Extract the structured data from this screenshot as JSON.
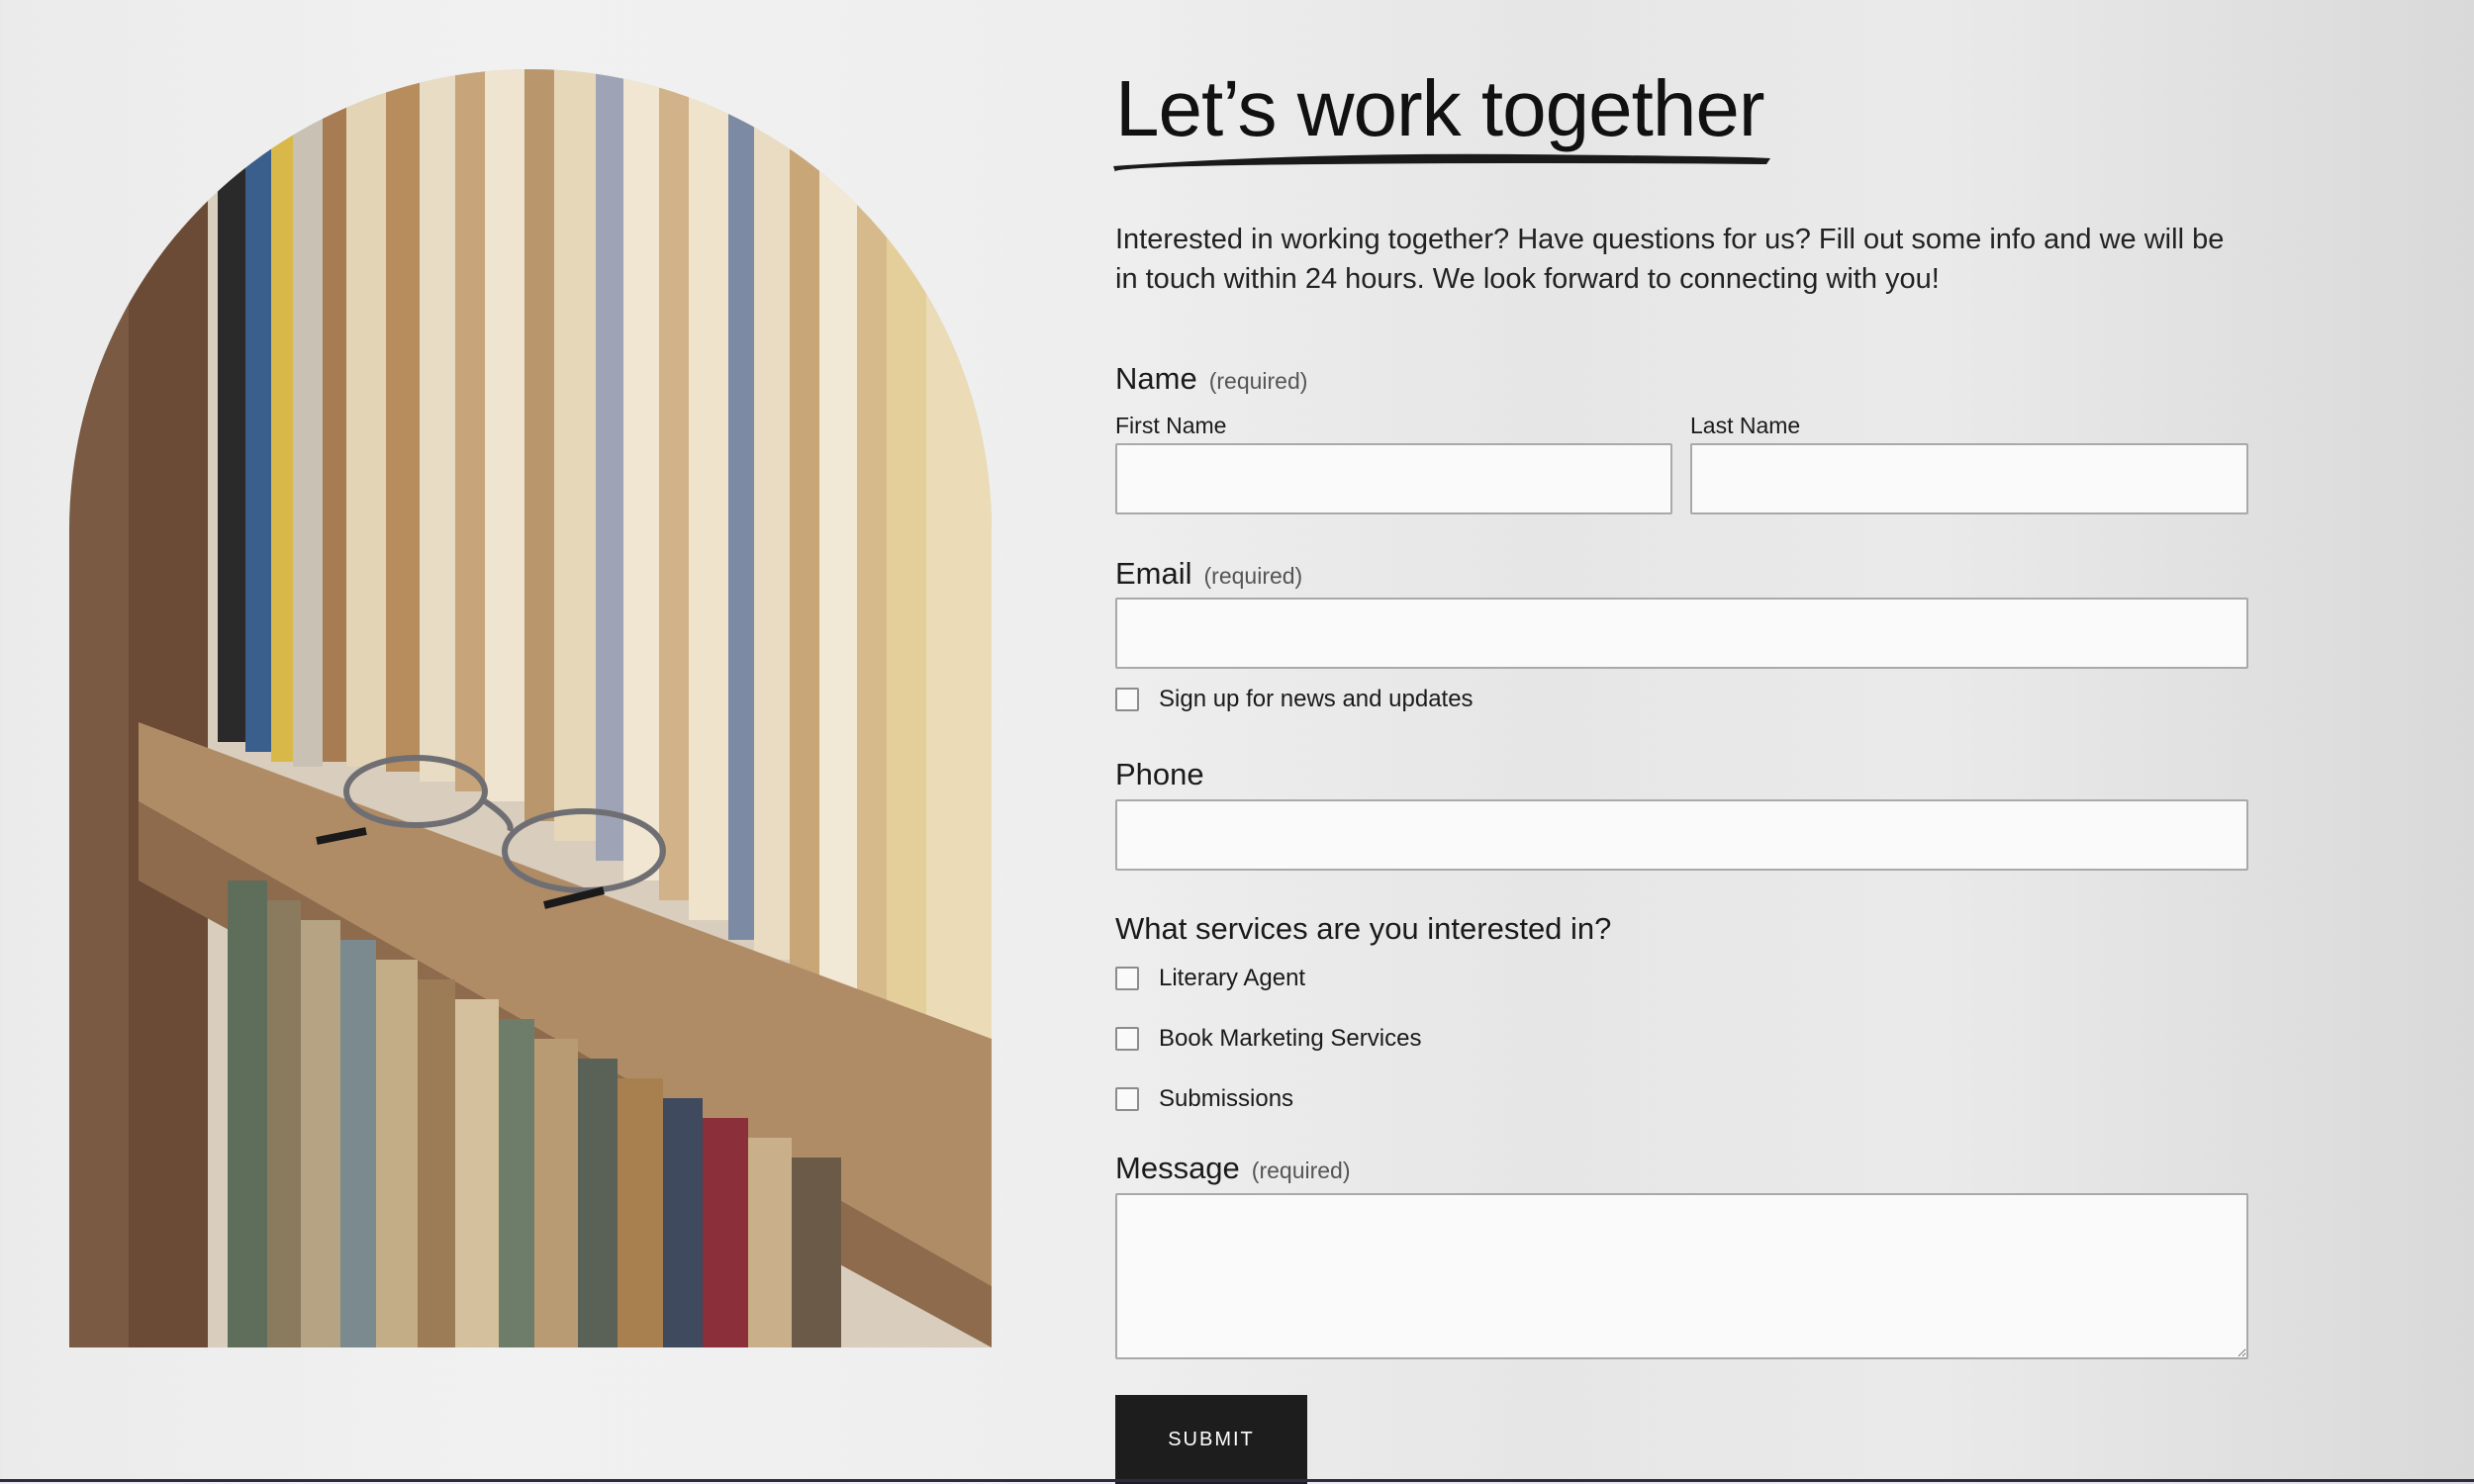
{
  "header": {
    "title": "Let’s work together",
    "intro": "Interested in working together? Have questions for us? Fill out some info and we will be in touch within 24 hours. We look forward to connecting with you!"
  },
  "form": {
    "name": {
      "label": "Name",
      "required": "(required)",
      "first_label": "First Name",
      "last_label": "Last Name",
      "first_value": "",
      "last_value": ""
    },
    "email": {
      "label": "Email",
      "required": "(required)",
      "value": "",
      "newsletter_label": "Sign up for news and updates",
      "newsletter_checked": false
    },
    "phone": {
      "label": "Phone",
      "value": ""
    },
    "services": {
      "label": "What services are you interested in?",
      "options": [
        {
          "label": "Literary Agent",
          "checked": false
        },
        {
          "label": "Book Marketing Services",
          "checked": false
        },
        {
          "label": "Submissions",
          "checked": false
        }
      ]
    },
    "message": {
      "label": "Message",
      "required": "(required)",
      "value": ""
    },
    "submit_label": "SUBMIT"
  },
  "colors": {
    "button_bg": "#1d1d1d",
    "input_border": "#a9a9a9",
    "input_bg": "#fafafa",
    "text": "#1a1a1a"
  }
}
